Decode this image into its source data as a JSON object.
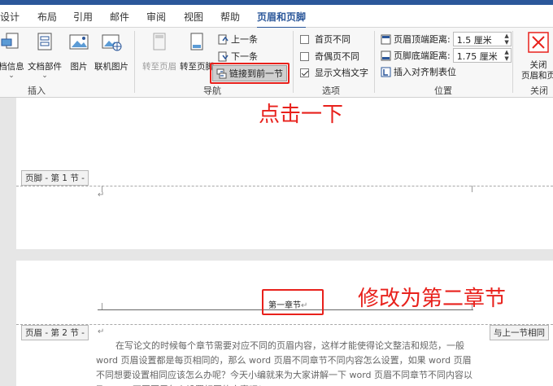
{
  "tabs": [
    "设计",
    "布局",
    "引用",
    "邮件",
    "审阅",
    "视图",
    "帮助",
    "页眉和页脚"
  ],
  "ribbon": {
    "insert_group": {
      "label": "插入",
      "buttons": [
        "档信息",
        "文档部件",
        "图片",
        "联机图片"
      ]
    },
    "nav_group": {
      "label": "导航",
      "goto_header": "转至页眉",
      "goto_footer": "转至页脚",
      "prev": "上一条",
      "next": "下一条",
      "link_prev": "链接到前一节"
    },
    "options_group": {
      "label": "选项",
      "first_page": "首页不同",
      "odd_even": "奇偶页不同",
      "show_doc_text": "显示文档文字"
    },
    "position_group": {
      "label": "位置",
      "header_top_label": "页眉顶端距离:",
      "header_top_value": "1.5 厘米",
      "footer_bottom_label": "页脚底端距离:",
      "footer_bottom_value": "1.75 厘米",
      "insert_align_tab": "插入对齐制表位"
    },
    "close_group": {
      "label": "关闭",
      "close_button": "关闭\n页眉和页"
    }
  },
  "annotations": {
    "click_once": "点击一下",
    "change_to": "修改为第二章节"
  },
  "document": {
    "footer_tag_1": "页脚 - 第 1 节 -",
    "header_tag_2": "页眉 - 第 2 节 -",
    "same_as_prev": "与上一节相同",
    "header_text": "第一章节",
    "paragraph": "在写论文的时候每个章节需要对应不同的页眉内容，这样才能使得论文整洁和规范，一般 word 页眉设置都是每页相同的，那么 word 页眉不同章节不同内容怎么设置，如果 word 页眉不同想要设置相同应该怎么办呢？今天小编就来为大家讲解一下 word 页眉不同章节不同内容以及 word 不同页眉怎么设置相同的方案吧！"
  }
}
